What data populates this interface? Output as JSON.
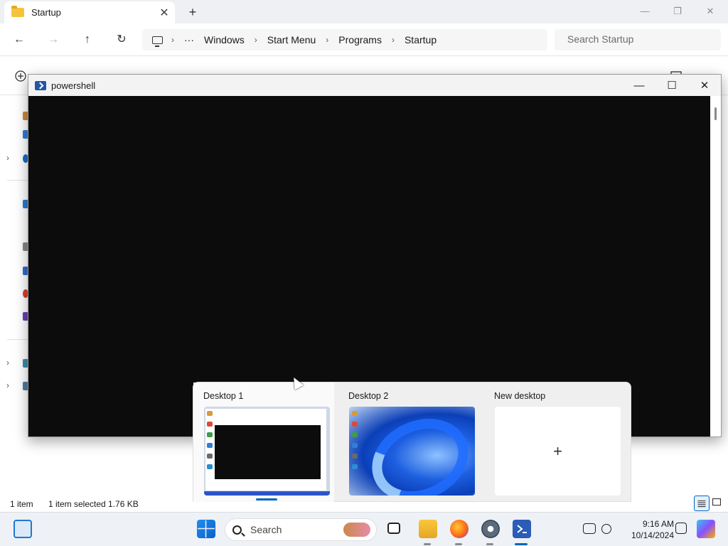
{
  "explorer": {
    "tab_title": "Startup",
    "tab_close": "✕",
    "new_tab": "+",
    "window_controls": {
      "minimize": "—",
      "maximize": "❐",
      "close": "✕"
    },
    "nav": {
      "back": "←",
      "forward": "→",
      "up": "↑",
      "refresh": "↻",
      "more": "···"
    },
    "breadcrumb": [
      "Windows",
      "Start Menu",
      "Programs",
      "Startup"
    ],
    "breadcrumb_separator": "›",
    "search_placeholder": "Search Startup",
    "status": {
      "count": "1 item",
      "selected": "1 item selected  1.76 KB"
    }
  },
  "powershell": {
    "title": "powershell",
    "controls": {
      "minimize": "—",
      "maximize": "☐",
      "close": "✕"
    }
  },
  "task_view": {
    "desktops": [
      {
        "label": "Desktop 1",
        "active": true
      },
      {
        "label": "Desktop 2",
        "active": false
      }
    ],
    "new_desktop": {
      "label": "New desktop",
      "plus": "+"
    }
  },
  "taskbar": {
    "search_label": "Search",
    "time": "9:16 AM",
    "date": "10/14/2024",
    "apps": [
      "widgets",
      "start",
      "search",
      "task-view",
      "file-explorer",
      "firefox",
      "settings",
      "powershell"
    ],
    "accent": "#0067c0"
  }
}
